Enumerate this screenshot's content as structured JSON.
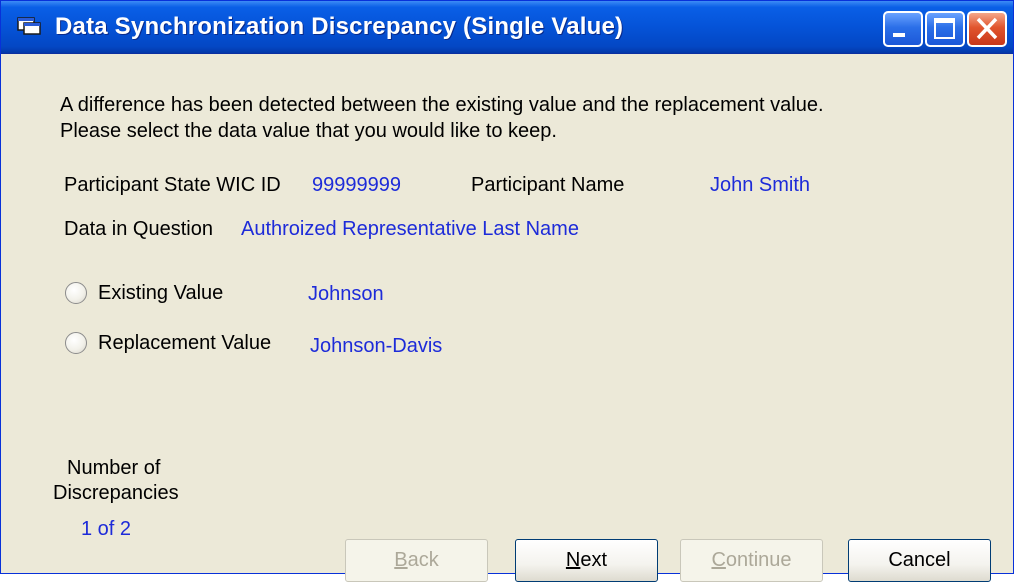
{
  "window": {
    "title": "Data Synchronization Discrepancy (Single Value)"
  },
  "message": {
    "line1": "A difference has been detected between the existing value and the replacement value.",
    "line2": "Please select the data value that you would like to keep."
  },
  "participant": {
    "id_label": "Participant State WIC ID",
    "id_value": "99999999",
    "name_label": "Participant Name",
    "name_value": "John Smith"
  },
  "data_in_question": {
    "label": "Data in Question",
    "value": "Authroized Representative Last Name"
  },
  "options": [
    {
      "label": "Existing Value",
      "value": "Johnson",
      "selected": false
    },
    {
      "label": "Replacement Value",
      "value": "Johnson-Davis",
      "selected": false
    }
  ],
  "discrepancies": {
    "label_line1": "Number of",
    "label_line2": "Discrepancies",
    "value": "1 of 2"
  },
  "buttons": {
    "back": {
      "prefix": "",
      "accel": "B",
      "rest": "ack",
      "enabled": false
    },
    "next": {
      "prefix": "",
      "accel": "N",
      "rest": "ext",
      "enabled": true
    },
    "continue": {
      "prefix": "",
      "accel": "C",
      "rest": "ontinue",
      "enabled": false
    },
    "cancel": {
      "label": "Cancel",
      "enabled": true
    }
  },
  "colors": {
    "value_text": "#1d2bd9",
    "title_bar": "#0553d8",
    "dialog_bg": "#ece9d8"
  },
  "icons": {
    "window": "dialog-app-icon",
    "minimize": "minimize-icon",
    "maximize": "maximize-icon",
    "close": "close-icon"
  }
}
